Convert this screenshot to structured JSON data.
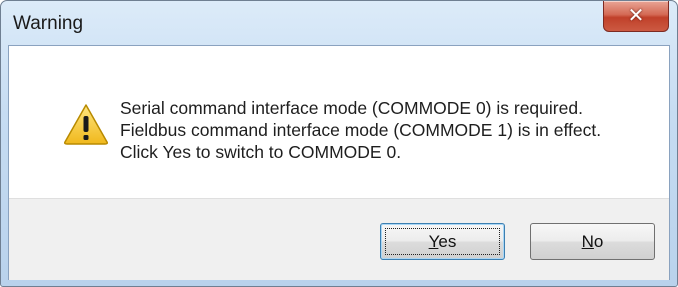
{
  "window": {
    "title": "Warning",
    "close_glyph": "✕"
  },
  "icon": {
    "name": "warning-icon",
    "color": "#f2c230"
  },
  "message": {
    "lines": [
      "Serial command interface mode (COMMODE 0) is required.",
      "Fieldbus command interface mode (COMMODE 1) is in effect.",
      "Click Yes to switch to COMMODE 0."
    ]
  },
  "buttons": {
    "yes": {
      "accel": "Y",
      "rest": "es"
    },
    "no": {
      "accel": "N",
      "rest": "o"
    }
  }
}
